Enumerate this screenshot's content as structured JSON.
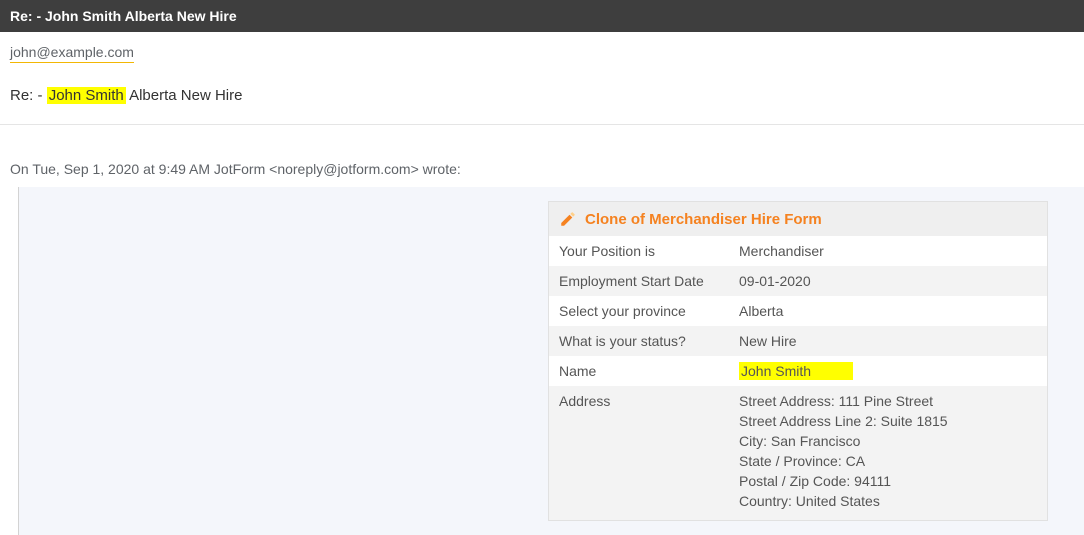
{
  "header": {
    "title": "Re: - John Smith Alberta New Hire"
  },
  "email": {
    "from": "john@example.com",
    "subject_prefix": "Re: - ",
    "subject_highlight": "John Smith",
    "subject_suffix": " Alberta New Hire",
    "quoted_intro": "On Tue, Sep 1, 2020 at 9:49 AM JotForm <noreply@jotform.com> wrote:"
  },
  "form": {
    "title": "Clone of Merchandiser Hire Form",
    "rows": {
      "position_label": "Your Position is",
      "position_value": "Merchandiser",
      "start_label": "Employment Start Date",
      "start_value": "09-01-2020",
      "province_label": "Select your province",
      "province_value": "Alberta",
      "status_label": "What is your status?",
      "status_value": "New Hire",
      "name_label": "Name",
      "name_value": "John Smith",
      "address_label": "Address",
      "address": {
        "street": "Street Address: 111 Pine Street",
        "street2": "Street Address Line 2: Suite 1815",
        "city": "City: San Francisco",
        "state": "State / Province: CA",
        "postal": "Postal / Zip Code: 94111",
        "country": "Country: United States"
      }
    }
  }
}
